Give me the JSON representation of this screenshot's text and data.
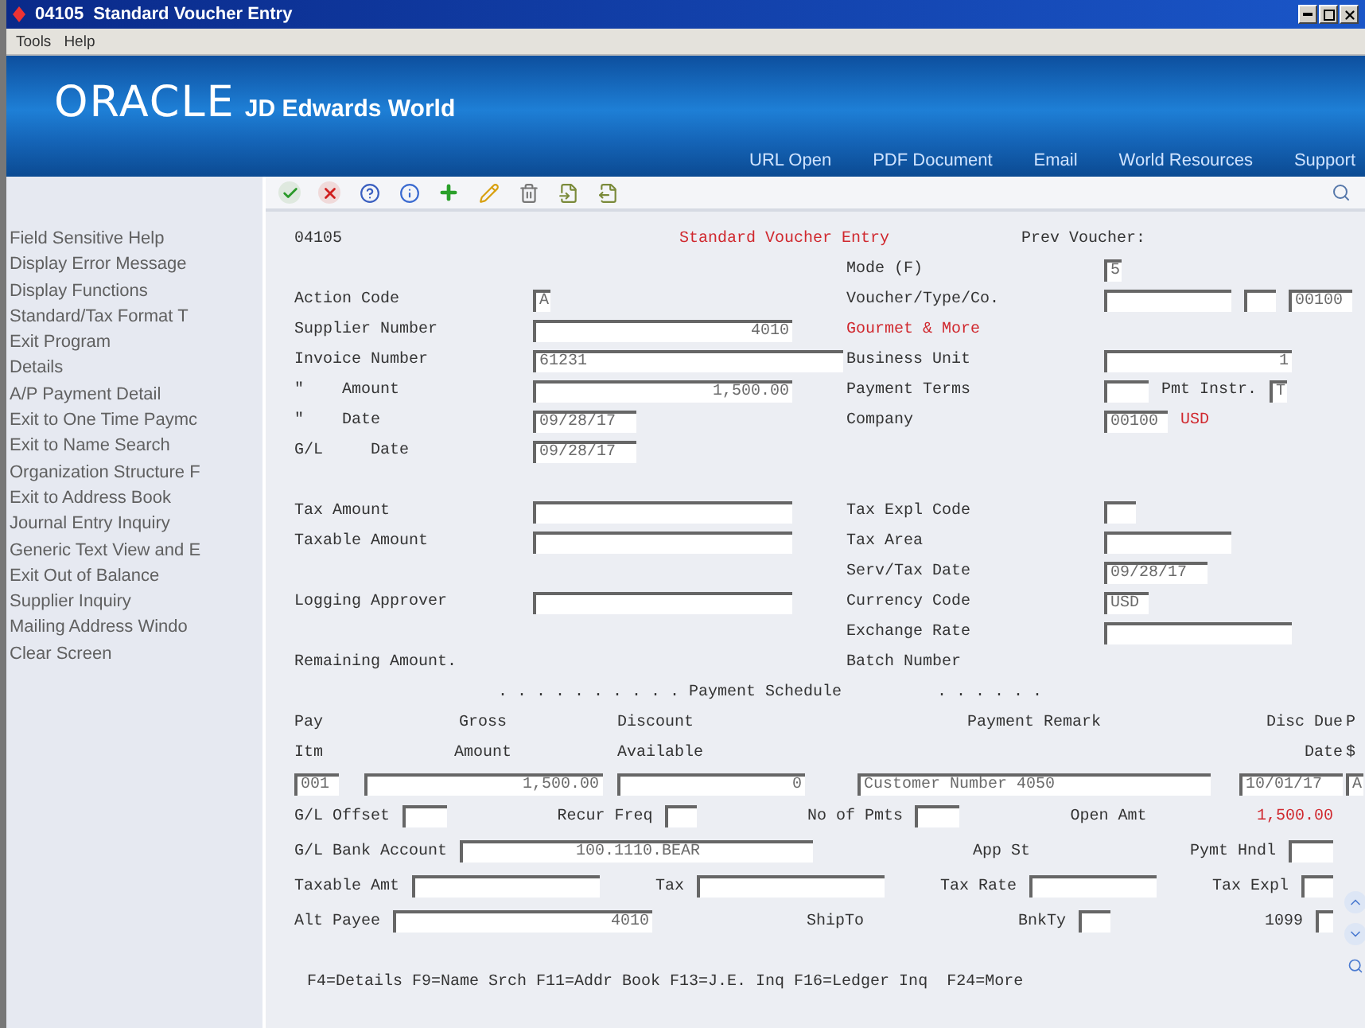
{
  "window": {
    "code": "04105",
    "title": "Standard Voucher Entry"
  },
  "menu": [
    "Tools",
    "Help"
  ],
  "banner": {
    "brand": "ORACLE",
    "product": "JD Edwards World",
    "links": [
      "URL Open",
      "PDF Document",
      "Email",
      "World Resources",
      "Support"
    ]
  },
  "sidebar": {
    "items": [
      "Field Sensitive Help",
      "Display Error Message",
      "Display Functions",
      "Standard/Tax Format T",
      "Exit Program",
      "Details",
      "A/P Payment Detail",
      "Exit to One Time Paymc",
      "Exit to Name Search",
      "Organization Structure F",
      "Exit to Address Book",
      "Journal Entry Inquiry",
      "Generic Text View and E",
      "Exit Out of Balance",
      "Supplier Inquiry",
      "Mailing Address Windo",
      "Clear Screen"
    ]
  },
  "form": {
    "program": "04105",
    "title": "Standard Voucher Entry",
    "prev_voucher_label": "Prev Voucher:",
    "rows": [
      {
        "right": {
          "label": "Mode (F)",
          "items": [
            {
              "kind": "char",
              "value": "5"
            }
          ]
        }
      },
      {
        "left": {
          "label": "Action Code",
          "items": [
            {
              "kind": "char",
              "value": "A"
            }
          ]
        },
        "right": {
          "label": "Voucher/Type/Co.",
          "items": [
            {
              "kind": "medium"
            },
            {
              "kind": "mini"
            },
            {
              "kind": "code",
              "value": "00100"
            }
          ]
        }
      },
      {
        "left": {
          "label": "Supplier Number",
          "items": [
            {
              "kind": "longnum",
              "value": "4010"
            }
          ]
        },
        "right": {
          "note": "Gourmet & More"
        }
      },
      {
        "left": {
          "label": "Invoice Number",
          "items": [
            {
              "kind": "xlong",
              "value": "61231"
            }
          ]
        },
        "right": {
          "label": "Business Unit",
          "items": [
            {
              "kind": "widenum",
              "value": "1"
            }
          ]
        }
      },
      {
        "left": {
          "label": "\"    Amount",
          "items": [
            {
              "kind": "longnum",
              "value": "1,500.00"
            }
          ]
        },
        "right": {
          "label": "Payment Terms",
          "items": [
            {
              "kind": "short"
            },
            {
              "kind": "label",
              "text": "Pmt Instr."
            },
            {
              "kind": "char",
              "value": "T"
            }
          ]
        }
      },
      {
        "left": {
          "label": "\"    Date",
          "items": [
            {
              "kind": "date",
              "value": "09/28/17"
            }
          ]
        },
        "right": {
          "label": "Company",
          "items": [
            {
              "kind": "code",
              "value": "00100"
            },
            {
              "kind": "note",
              "text": "USD"
            }
          ]
        }
      },
      {
        "left": {
          "label": "G/L     Date",
          "items": [
            {
              "kind": "date",
              "value": "09/28/17"
            }
          ]
        }
      },
      {},
      {
        "left": {
          "label": "Tax Amount",
          "items": [
            {
              "kind": "long"
            }
          ]
        },
        "right": {
          "label": "Tax Expl Code",
          "items": [
            {
              "kind": "mini"
            }
          ]
        }
      },
      {
        "left": {
          "label": "Taxable Amount",
          "items": [
            {
              "kind": "long"
            }
          ]
        },
        "right": {
          "label": "Tax Area",
          "items": [
            {
              "kind": "medium"
            }
          ]
        }
      },
      {
        "right": {
          "label": "Serv/Tax Date",
          "items": [
            {
              "kind": "date",
              "value": "09/28/17"
            }
          ]
        }
      },
      {
        "left": {
          "label": "Logging Approver",
          "items": [
            {
              "kind": "long"
            }
          ]
        },
        "right": {
          "label": "Currency Code",
          "items": [
            {
              "kind": "short",
              "value": "USD"
            }
          ]
        }
      },
      {
        "right": {
          "label": "Exchange Rate",
          "items": [
            {
              "kind": "wide"
            }
          ]
        }
      },
      {
        "left": {
          "label": "Remaining Amount."
        },
        "right": {
          "label": "Batch Number"
        }
      }
    ]
  },
  "schedule": {
    "caption": ". . . . . . . . . . Payment Schedule          . . . . . .",
    "columns": [
      {
        "title": "Pay",
        "subtitle": "Itm"
      },
      {
        "title": "Gross",
        "subtitle": "Amount"
      },
      {
        "title": "Discount",
        "subtitle": "Available"
      },
      {
        "title": "Payment Remark"
      },
      {
        "title": "Disc Due",
        "subtitle": "Date"
      },
      {
        "title": "P",
        "subtitle": "$"
      }
    ],
    "entry": [
      {
        "kind": "short",
        "value": "001"
      },
      {
        "kind": "grossnum",
        "value": "1,500.00"
      },
      {
        "kind": "widenum",
        "value": "0"
      },
      {
        "kind": "huge",
        "value": "Customer Number 4050"
      },
      {
        "kind": "date",
        "value": "10/01/17"
      },
      {
        "kind": "char",
        "value": "A"
      }
    ],
    "rows": [
      [
        {
          "label": "G/L Offset",
          "items": [
            {
              "kind": "short"
            }
          ]
        },
        {
          "label": "Recur Freq",
          "items": [
            {
              "kind": "mini"
            }
          ]
        },
        {
          "label": "No of Pmts",
          "items": [
            {
              "kind": "short"
            }
          ]
        },
        {
          "label": "Open Amt"
        },
        {
          "items": [
            {
              "kind": "note",
              "text": "1,500.00"
            }
          ]
        }
      ],
      [
        {
          "label": "G/L Bank Account",
          "items": [
            {
              "kind": "hugecenter",
              "value": "100.1110.BEAR"
            }
          ]
        },
        {
          "label": "App St"
        },
        {
          "label": "Pymt Hndl",
          "items": [
            {
              "kind": "short"
            }
          ]
        }
      ],
      [
        {
          "label": "Taxable Amt",
          "items": [
            {
              "kind": "wide"
            }
          ]
        },
        {
          "label": "Tax",
          "items": [
            {
              "kind": "wide"
            }
          ]
        },
        {
          "label": "Tax Rate",
          "items": [
            {
              "kind": "medium"
            }
          ]
        },
        {
          "label": "Tax Expl",
          "items": [
            {
              "kind": "mini"
            }
          ]
        }
      ],
      [
        {
          "label": "Alt Payee",
          "items": [
            {
              "kind": "longnum",
              "value": "4010"
            }
          ]
        },
        {
          "label": "ShipTo"
        },
        {
          "label": "BnkTy",
          "items": [
            {
              "kind": "mini"
            }
          ]
        },
        {
          "label": "1099",
          "items": [
            {
              "kind": "char"
            }
          ]
        }
      ]
    ]
  },
  "function_keys": "F4=Details F9=Name Srch F11=Addr Book F13=J.E. Inq F16=Ledger Inq  F24=More"
}
